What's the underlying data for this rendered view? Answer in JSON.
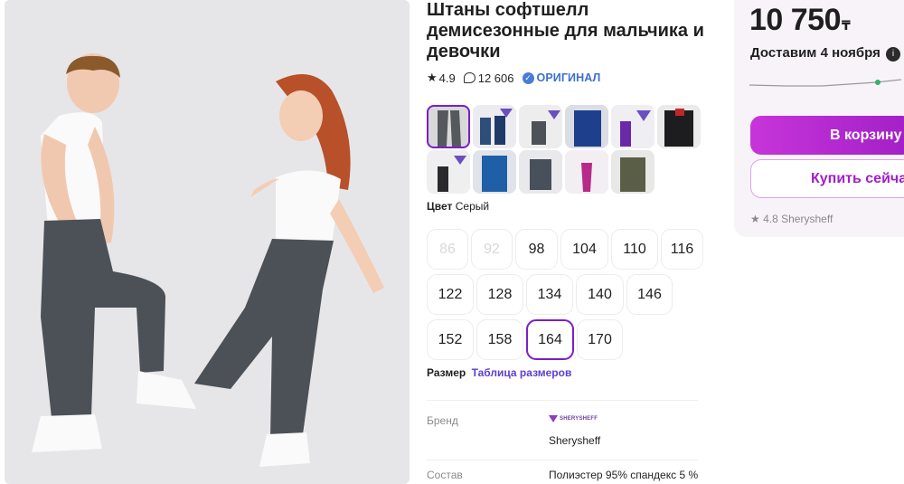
{
  "product": {
    "title": "Штаны софтшелл демисезонные для мальчика и девочки",
    "rating": "4.9",
    "reviews": "12 606",
    "original_badge": "ОРИГИНАЛ"
  },
  "thumbnails": [
    {
      "name": "thumb-1",
      "selected": true
    },
    {
      "name": "thumb-2",
      "selected": false
    },
    {
      "name": "thumb-3",
      "selected": false
    },
    {
      "name": "thumb-4",
      "selected": false
    },
    {
      "name": "thumb-5",
      "selected": false
    },
    {
      "name": "thumb-6",
      "selected": false
    },
    {
      "name": "thumb-7",
      "selected": false
    },
    {
      "name": "thumb-8",
      "selected": false
    },
    {
      "name": "thumb-9",
      "selected": false
    },
    {
      "name": "thumb-10",
      "selected": false
    },
    {
      "name": "thumb-11",
      "selected": false
    }
  ],
  "color": {
    "label": "Цвет",
    "value": "Серый"
  },
  "sizes": [
    {
      "label": "86",
      "state": "disabled"
    },
    {
      "label": "92",
      "state": "disabled"
    },
    {
      "label": "98",
      "state": "available"
    },
    {
      "label": "104",
      "state": "available"
    },
    {
      "label": "110",
      "state": "available"
    },
    {
      "label": "116",
      "state": "available"
    },
    {
      "label": "122",
      "state": "available"
    },
    {
      "label": "128",
      "state": "available"
    },
    {
      "label": "134",
      "state": "available"
    },
    {
      "label": "140",
      "state": "available"
    },
    {
      "label": "146",
      "state": "available"
    },
    {
      "label": "152",
      "state": "available"
    },
    {
      "label": "158",
      "state": "available"
    },
    {
      "label": "164",
      "state": "selected"
    },
    {
      "label": "170",
      "state": "available"
    }
  ],
  "size_info": {
    "label": "Размер",
    "link": "Таблица размеров"
  },
  "specs": {
    "brand_label": "Бренд",
    "brand_logo_text": "SHERYSHEFF",
    "brand_value": "Sherysheff",
    "material_label": "Состав",
    "material_value": "Полиэстер 95% спандекс 5 %"
  },
  "buy": {
    "price": "10 750",
    "currency": "₸",
    "delivery": "Доставим 4 ноября",
    "cart_button": "В корзину",
    "buy_now_button": "Купить сейчас",
    "seller": "4.8 Sherysheff"
  },
  "colors": {
    "accent": "#a21fc7",
    "selected_border": "#7a1fc9",
    "link": "#5b3fd1",
    "badge": "#3d6fcf"
  }
}
